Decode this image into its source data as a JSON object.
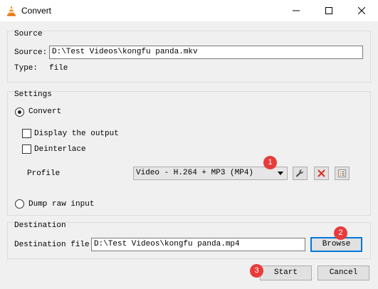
{
  "window": {
    "title": "Convert",
    "icon": "vlc-cone-icon"
  },
  "source": {
    "group_title": "Source",
    "source_label": "Source:",
    "source_value": "D:\\Test Videos\\kongfu panda.mkv",
    "type_label": "Type:",
    "type_value": "file"
  },
  "settings": {
    "group_title": "Settings",
    "convert_label": "Convert",
    "convert_selected": true,
    "display_output_label": "Display the output",
    "deinterlace_label": "Deinterlace",
    "profile_label": "Profile",
    "profile_value": "Video - H.264 + MP3 (MP4)",
    "dump_raw_label": "Dump raw input"
  },
  "destination": {
    "group_title": "Destination",
    "file_label": "Destination file:",
    "file_value": "D:\\Test Videos\\kongfu panda.mp4",
    "browse_label": "Browse"
  },
  "actions": {
    "start_label": "Start",
    "cancel_label": "Cancel"
  },
  "markers": [
    "1",
    "2",
    "3"
  ],
  "colors": {
    "marker": "#e83b3b",
    "focus_border": "#0078d7",
    "delete_red": "#d93025"
  }
}
